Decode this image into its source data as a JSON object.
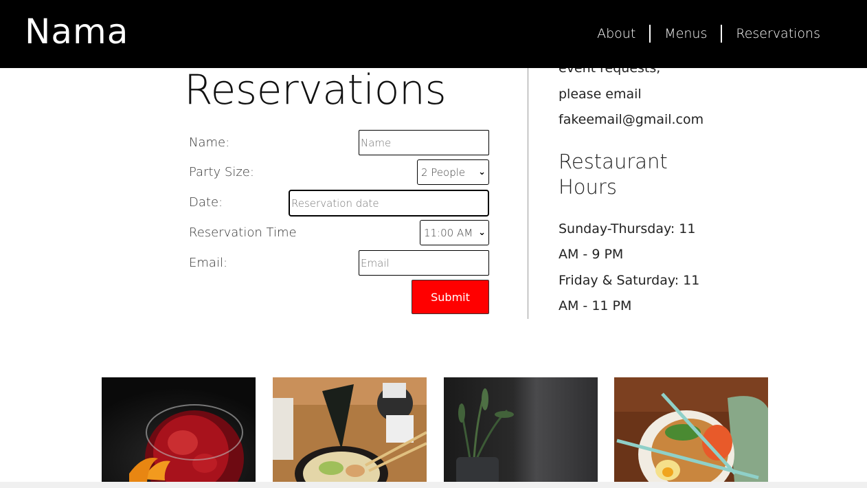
{
  "brand": {
    "logo": "Nama"
  },
  "nav": {
    "about": "About",
    "menus": "Menus",
    "reservations": "Reservations"
  },
  "reservation_form": {
    "title": "Reservations",
    "name_label": "Name:",
    "name_placeholder": "Name",
    "party_size_label": "Party Size:",
    "party_size_value": "2 People",
    "date_label": "Date:",
    "date_placeholder": "Reservation date",
    "time_label": "Reservation Time",
    "time_value": "11:00 AM",
    "email_label": "Email:",
    "email_placeholder": "Email",
    "submit_label": "Submit",
    "submit_color": "#ff0000"
  },
  "info": {
    "contact_lines": [
      "event requests,",
      "please email",
      "fakeemail@gmail.com"
    ],
    "hours_heading": [
      "Restaurant",
      "Hours"
    ],
    "hours_lines": [
      "Sunday-Thursday: 11",
      "AM - 9 PM",
      "Friday & Saturday: 11",
      "AM - 11 PM"
    ]
  },
  "gallery": [
    {
      "icon": "cocktail-photo"
    },
    {
      "icon": "ramen-photo"
    },
    {
      "icon": "plant-photo"
    },
    {
      "icon": "noodle-bowl-photo"
    }
  ]
}
